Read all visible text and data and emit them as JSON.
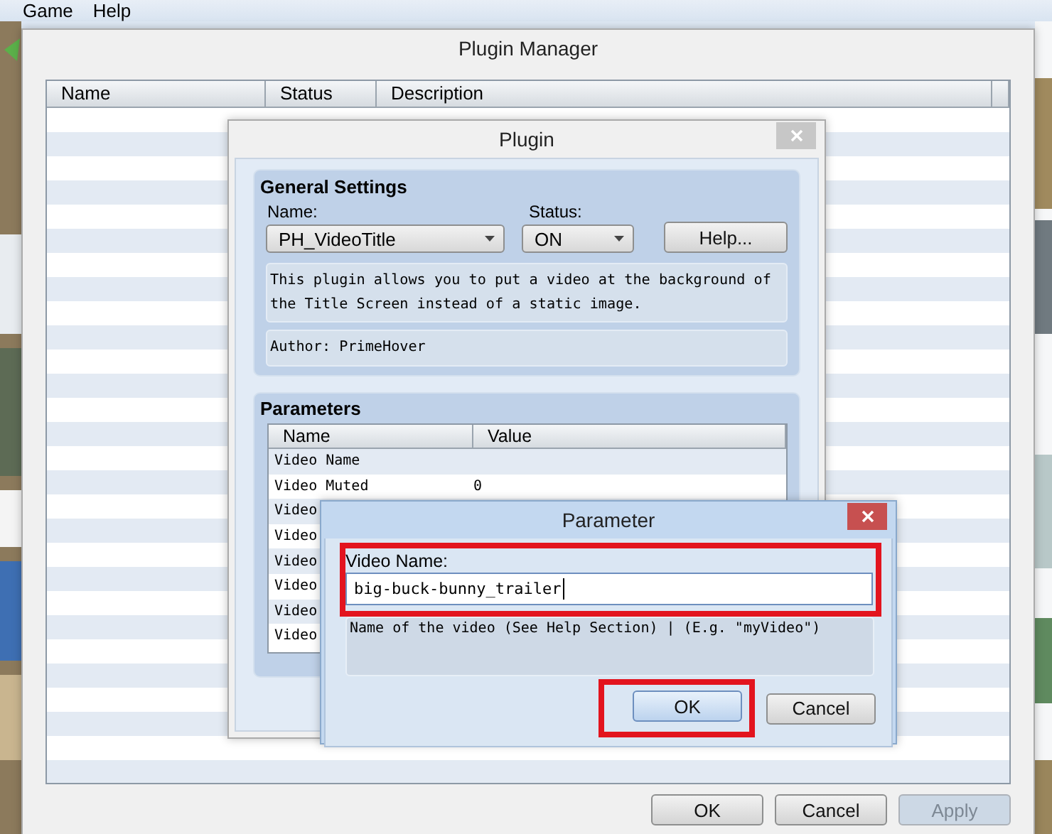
{
  "menu": [
    {
      "label": "Game"
    },
    {
      "label": "Help"
    }
  ],
  "plugin_manager": {
    "title": "Plugin Manager",
    "columns": [
      "Name",
      "Status",
      "Description"
    ],
    "buttons": [
      {
        "label": "OK",
        "disabled": false
      },
      {
        "label": "Cancel",
        "disabled": false
      },
      {
        "label": "Apply",
        "disabled": true
      }
    ]
  },
  "plugin_dialog": {
    "title": "Plugin",
    "general_settings": {
      "title": "General Settings",
      "name_label": "Name:",
      "name_value": "PH_VideoTitle",
      "status_label": "Status:",
      "status_value": "ON",
      "help_button": "Help...",
      "description": "This plugin allows you to put a video at the background of the Title Screen instead of a static image.",
      "author": "Author: PrimeHover"
    },
    "parameters": {
      "title": "Parameters",
      "columns": [
        "Name",
        "Value"
      ],
      "rows": [
        {
          "name": "Video Name"
        },
        {
          "name": "Video Muted",
          "value": "0"
        },
        {
          "name": "Video"
        },
        {
          "name": "Video"
        },
        {
          "name": "Video"
        },
        {
          "name": "Video"
        },
        {
          "name": "Video"
        },
        {
          "name": "Video"
        }
      ]
    }
  },
  "parameter_dialog": {
    "title": "Parameter",
    "field_label": "Video Name:",
    "field_value": "big-buck-bunny_trailer",
    "field_highlighted": true,
    "help_text": "Name of the video (See Help Section) | (E.g. \"myVideo\")",
    "buttons": [
      {
        "label": "OK",
        "default": true,
        "highlighted": true
      },
      {
        "label": "Cancel",
        "default": false,
        "highlighted": false
      }
    ]
  }
}
